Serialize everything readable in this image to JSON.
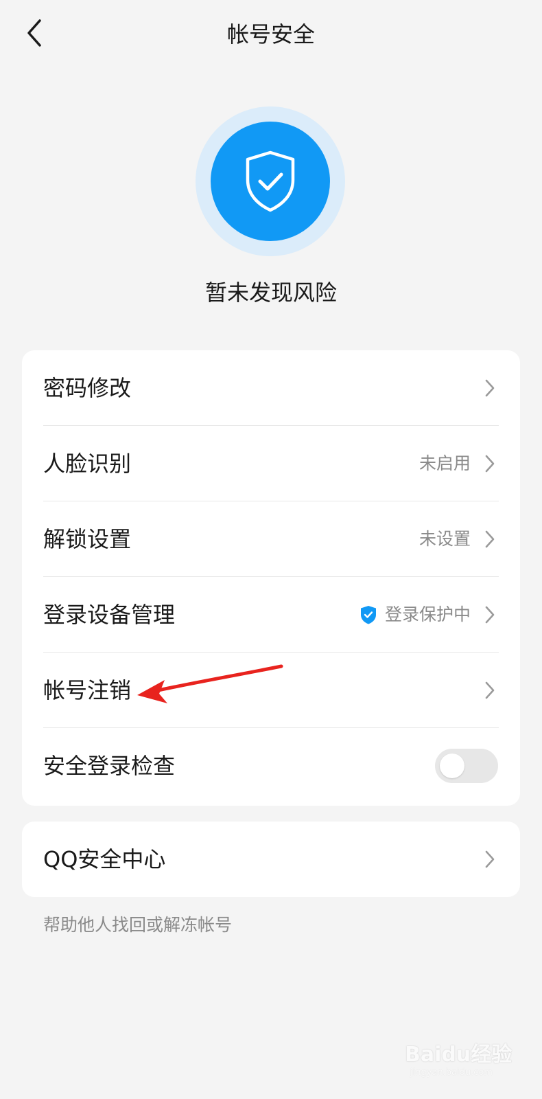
{
  "header": {
    "title": "帐号安全",
    "back_icon": "chevron-left-icon"
  },
  "status": {
    "icon": "shield-check-icon",
    "text": "暂未发现风险",
    "colors": {
      "outer": "#dbecfa",
      "inner": "#1199f5"
    }
  },
  "settings": {
    "items": [
      {
        "label": "密码修改",
        "value": ""
      },
      {
        "label": "人脸识别",
        "value": "未启用"
      },
      {
        "label": "解锁设置",
        "value": "未设置"
      },
      {
        "label": "登录设备管理",
        "value": "登录保护中",
        "value_icon": "shield-check-icon"
      },
      {
        "label": "帐号注销",
        "value": ""
      },
      {
        "label": "安全登录检查",
        "toggle": false
      }
    ]
  },
  "qq_center": {
    "label": "QQ安全中心"
  },
  "help_link": "帮助他人找回或解冻帐号",
  "annotation": {
    "type": "red-arrow",
    "points_to": "帐号注销",
    "color": "#e8231e"
  },
  "watermark": {
    "brand": "Baidu经验",
    "site": "jingyan.baidu.com"
  }
}
